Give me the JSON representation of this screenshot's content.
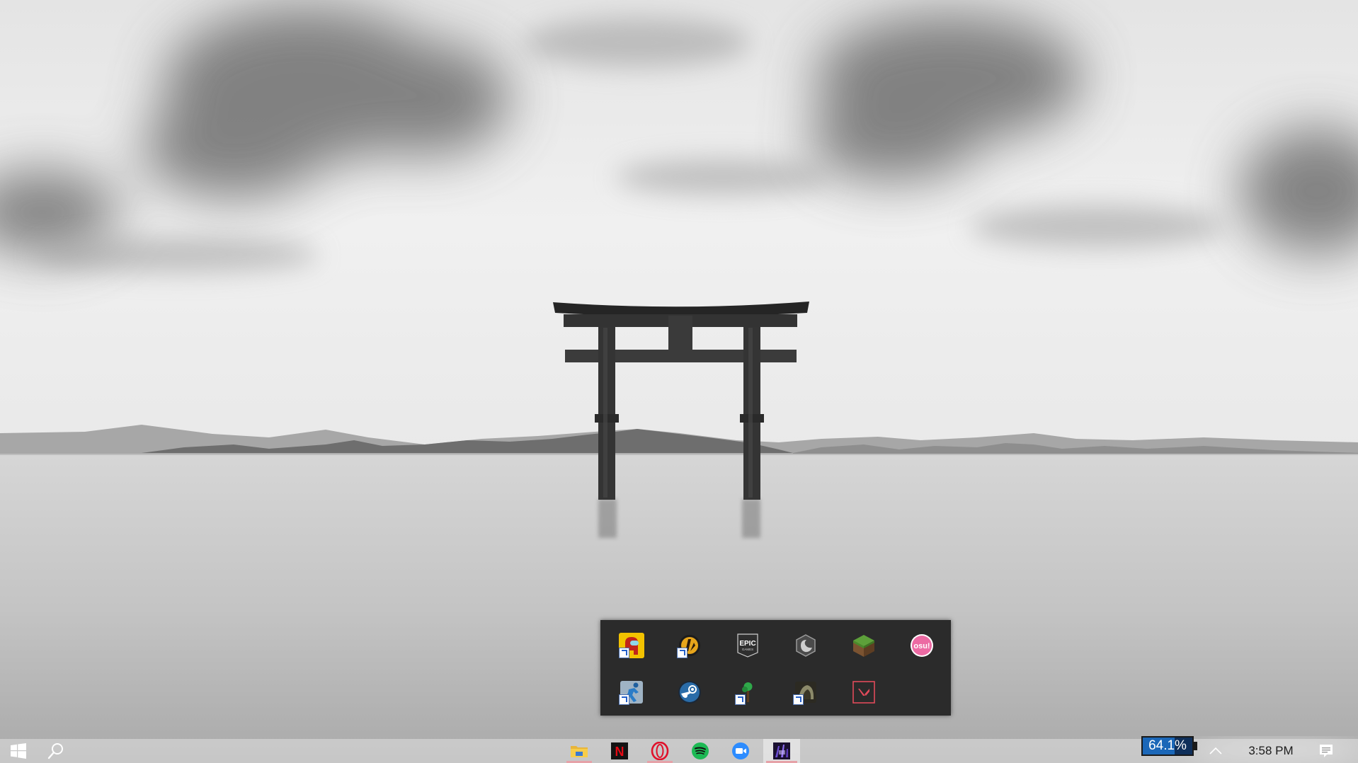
{
  "wallpaper": {
    "subject": "torii-gate-in-lake",
    "tone": "monochrome"
  },
  "popup": {
    "apps": [
      {
        "name": "among-us",
        "icon": "among-us-icon",
        "shortcut": true
      },
      {
        "name": "app-2",
        "icon": "yellow-emblem-icon",
        "shortcut": true
      },
      {
        "name": "epic-games",
        "icon": "epic-games-icon",
        "label": "EPIC",
        "sublabel": "GAMES",
        "shortcut": false
      },
      {
        "name": "app-4",
        "icon": "grey-badge-icon",
        "shortcut": false
      },
      {
        "name": "minecraft",
        "icon": "minecraft-icon",
        "shortcut": false
      },
      {
        "name": "osu",
        "icon": "osu-icon",
        "label": "osu!",
        "shortcut": false
      },
      {
        "name": "app-7",
        "icon": "runner-icon",
        "shortcut": true
      },
      {
        "name": "steam",
        "icon": "steam-icon",
        "shortcut": false
      },
      {
        "name": "app-9",
        "icon": "green-tree-icon",
        "shortcut": true
      },
      {
        "name": "app-10",
        "icon": "dark-game-icon",
        "shortcut": true
      },
      {
        "name": "valorant",
        "icon": "valorant-icon",
        "shortcut": false
      }
    ]
  },
  "taskbar": {
    "start": {
      "icon": "windows-logo-icon"
    },
    "search": {
      "icon": "search-icon"
    },
    "apps": [
      {
        "name": "file-explorer",
        "icon": "folder-icon",
        "running": true,
        "active": false
      },
      {
        "name": "netflix",
        "icon": "netflix-icon",
        "label": "N",
        "running": false,
        "active": false
      },
      {
        "name": "opera",
        "icon": "opera-icon",
        "running": true,
        "active": false
      },
      {
        "name": "spotify",
        "icon": "spotify-icon",
        "running": false,
        "active": false
      },
      {
        "name": "zoom",
        "icon": "zoom-icon",
        "running": false,
        "active": false
      },
      {
        "name": "games-folder",
        "icon": "purple-folder-icon",
        "running": true,
        "active": true
      }
    ],
    "battery": {
      "label": "64.1%",
      "level": 0.641
    },
    "tray_overflow": {
      "icon": "chevron-up-icon"
    },
    "clock": {
      "time": "3:58 PM"
    },
    "notifications": {
      "icon": "action-center-icon"
    }
  },
  "colors": {
    "popup_bg": "#2b2b2b",
    "running_indicator": "#e6a2a8",
    "battery_fill": "#1b67b8",
    "osu_pink": "#ec6aa3",
    "spotify_green": "#1db954",
    "zoom_blue": "#2d8cff",
    "netflix_red": "#e50914"
  }
}
